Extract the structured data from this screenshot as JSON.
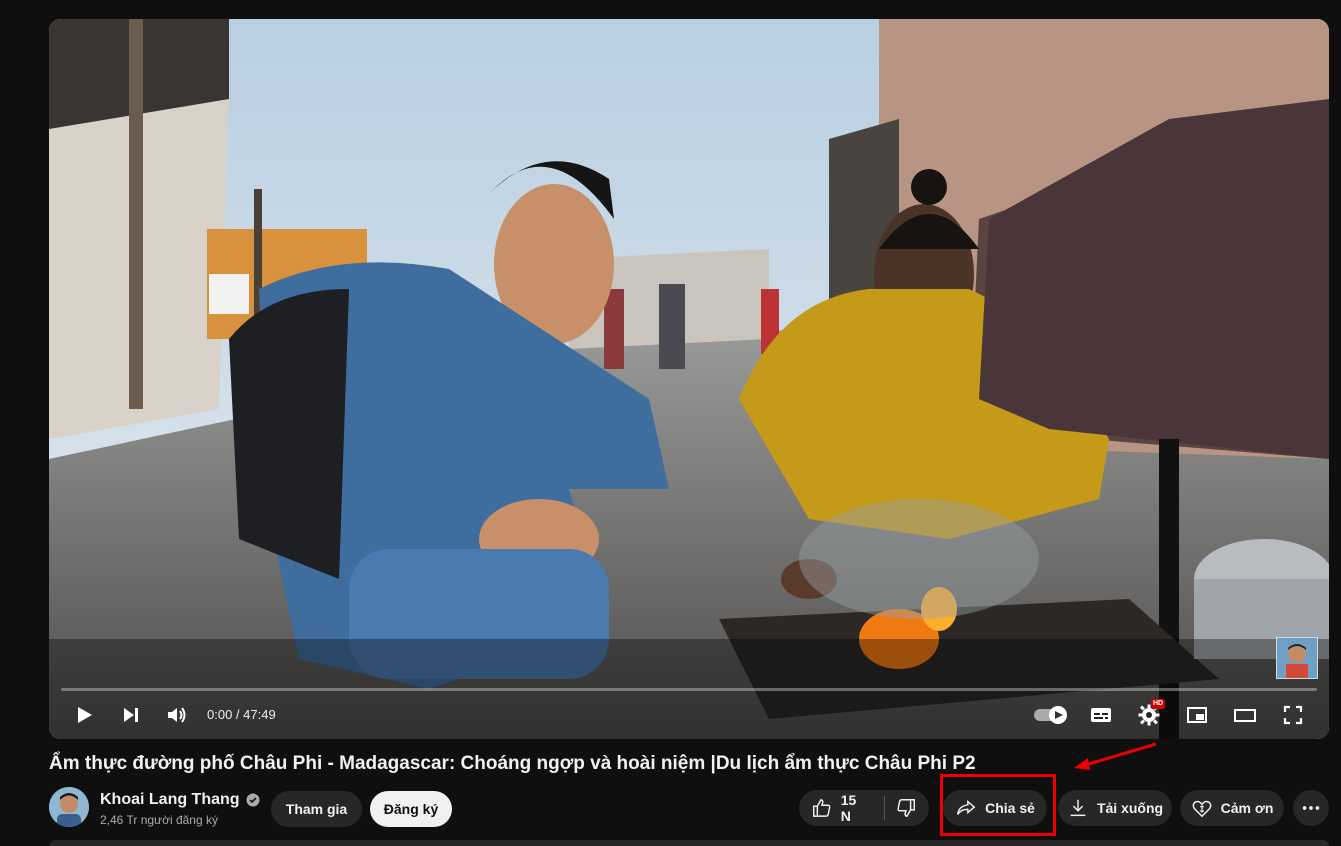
{
  "player": {
    "time_display": "0:00 / 47:49",
    "progress": 0.0,
    "hd_badge": "HD",
    "controls": [
      "play",
      "next",
      "volume",
      "autoplay",
      "subtitles",
      "settings",
      "miniplayer",
      "theater",
      "fullscreen"
    ]
  },
  "video": {
    "title": "Ẩm thực đường phố Châu Phi - Madagascar: Choáng ngợp và hoài niệm |Du lịch ẩm thực Châu Phi P2"
  },
  "channel": {
    "name": "Khoai Lang Thang",
    "verified": true,
    "subscribers": "2,46 Tr người đăng ký",
    "join_label": "Tham gia",
    "subscribe_label": "Đăng ký"
  },
  "actions": {
    "like_count": "15 N",
    "share_label": "Chia sẻ",
    "download_label": "Tải xuống",
    "thanks_label": "Cảm ơn"
  },
  "colors": {
    "background": "#0f0f0f",
    "pill": "#272727",
    "highlight": "#e00000",
    "progress": "#ff0000"
  }
}
